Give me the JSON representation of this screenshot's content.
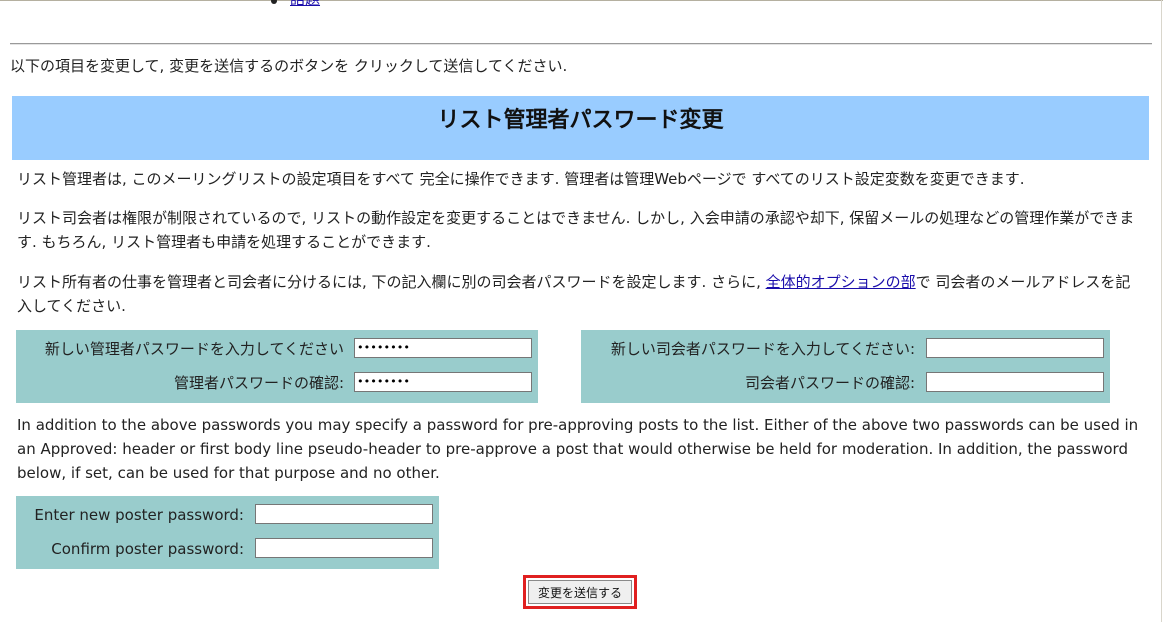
{
  "nav_fragment": {
    "link_label": "話題"
  },
  "intro_text": "以下の項目を変更して, 変更を送信するのボタンを クリックして送信してください.",
  "section_title": "リスト管理者パスワード変更",
  "paragraphs": {
    "p1": "リスト管理者は, このメーリングリストの設定項目をすべて 完全に操作できます. 管理者は管理Webページで すべてのリスト設定変数を変更できます.",
    "p2": "リスト司会者は権限が制限されているので, リストの動作設定を変更することはできません. しかし, 入会申請の承認や却下, 保留メールの処理などの管理作業ができます. もちろん, リスト管理者も申請を処理することができます.",
    "p3_before": "リスト所有者の仕事を管理者と司会者に分けるには, 下の記入欄に別の司会者パスワードを設定します. さらに, ",
    "p3_link": "全体的オプションの部",
    "p3_after": "で 司会者のメールアドレスを記入してください.",
    "p4": "In addition to the above passwords you may specify a password for pre-approving posts to the list. Either of the above two passwords can be used in an Approved: header or first body line pseudo-header to pre-approve a post that would otherwise be held for moderation. In addition, the password below, if set, can be used for that purpose and no other."
  },
  "admin_password": {
    "new_label": "新しい管理者パスワードを入力してください",
    "new_value": "••••••••",
    "confirm_label": "管理者パスワードの確認:",
    "confirm_value": "••••••••"
  },
  "moderator_password": {
    "new_label": "新しい司会者パスワードを入力してください:",
    "new_value": "",
    "confirm_label": "司会者パスワードの確認:",
    "confirm_value": ""
  },
  "poster_password": {
    "new_label": "Enter new poster password:",
    "new_value": "",
    "confirm_label": "Confirm poster password:",
    "confirm_value": ""
  },
  "submit_label": "変更を送信する"
}
